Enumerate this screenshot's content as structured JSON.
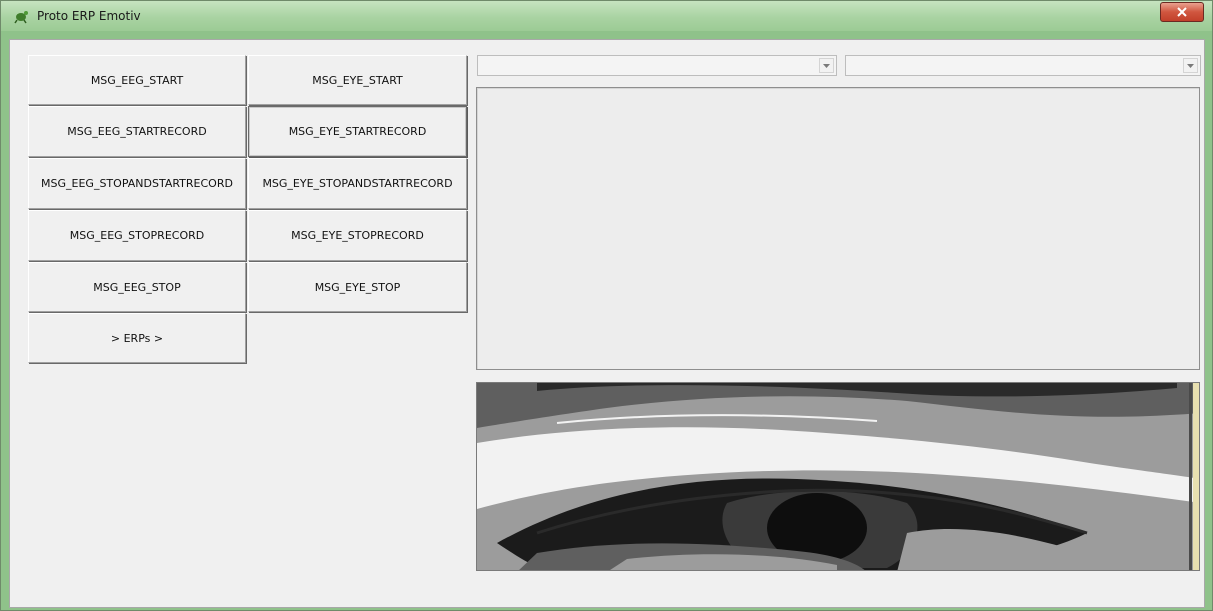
{
  "window": {
    "title": "Proto ERP Emotiv",
    "title_icon": "turtle-icon",
    "close_icon": "close-icon"
  },
  "buttons": {
    "eeg_start": "MSG_EEG_START",
    "eye_start": "MSG_EYE_START",
    "eeg_startrecord": "MSG_EEG_STARTRECORD",
    "eye_startrecord": "MSG_EYE_STARTRECORD",
    "eeg_stopandstartrecord": "MSG_EEG_STOPANDSTARTRECORD",
    "eye_stopandstartrecord": "MSG_EYE_STOPANDSTARTRECORD",
    "eeg_stoprecord": "MSG_EEG_STOPRECORD",
    "eye_stoprecord": "MSG_EYE_STOPRECORD",
    "eeg_stop": "MSG_EEG_STOP",
    "eye_stop": "MSG_EYE_STOP",
    "erps": "> ERPs >"
  },
  "combos": {
    "left_value": "",
    "right_value": "",
    "arrow_icon": "chevron-down-icon"
  },
  "image": {
    "subject": "eye-image",
    "palette": [
      "#1b1b1b",
      "#5f5f5f",
      "#9c9c9c",
      "#f2f2f2"
    ]
  },
  "colors": {
    "title_bar": "#a9d3a2",
    "close_button": "#d0563f",
    "window_bg": "#f0f0f0"
  }
}
